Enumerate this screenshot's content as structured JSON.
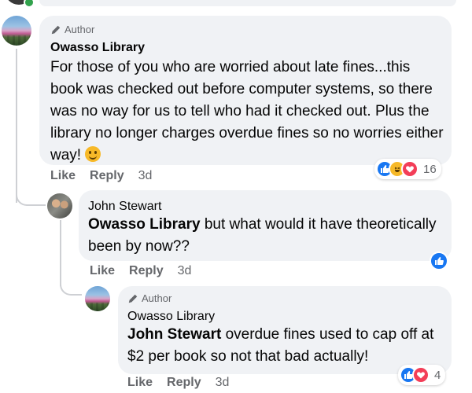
{
  "comments": [
    {
      "badge": "Author",
      "name": "Owasso Library",
      "text": "For those of you who are worried about late fines...this book was checked out before computer systems, so there was no way for us to tell who had it checked out. Plus the library no longer charges overdue fines so no worries either way!",
      "actions": {
        "like": "Like",
        "reply": "Reply",
        "time": "3d"
      },
      "reactions": {
        "types": [
          "like",
          "haha",
          "love"
        ],
        "count": "16"
      }
    },
    {
      "name": "John Stewart",
      "mention": "Owasso Library",
      "text": " but what would it have theoretically been by now??",
      "actions": {
        "like": "Like",
        "reply": "Reply",
        "time": "3d"
      },
      "reactions": {
        "types": [
          "like"
        ]
      }
    },
    {
      "badge": "Author",
      "name": "Owasso Library",
      "mention": "John Stewart",
      "text": " overdue fines used to cap off at $2 per book so not that bad actually!",
      "actions": {
        "like": "Like",
        "reply": "Reply",
        "time": "3d"
      },
      "reactions": {
        "types": [
          "like",
          "love"
        ],
        "count": "4"
      }
    }
  ],
  "colors": {
    "bubble": "#f0f2f5",
    "secondary_text": "#65676b",
    "like_blue": "#1877f2",
    "love_red": "#f33e58",
    "haha_yellow": "#f7b928"
  }
}
